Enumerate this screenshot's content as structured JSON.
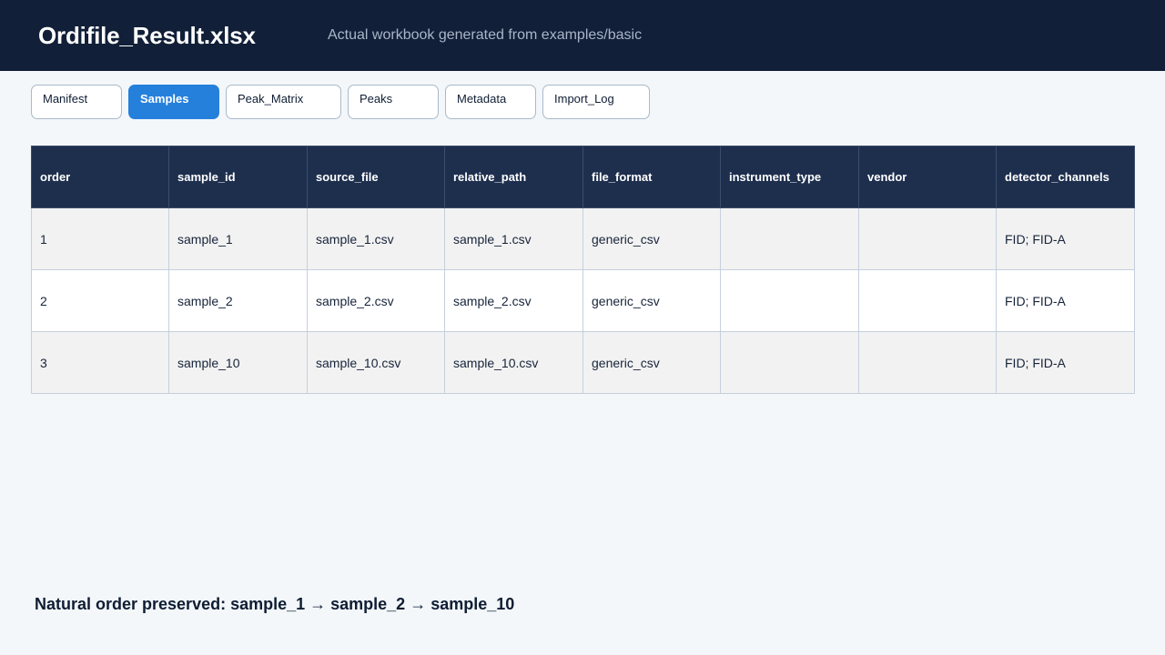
{
  "header": {
    "title": "Ordifile_Result.xlsx",
    "subtitle": "Actual workbook generated from examples/basic"
  },
  "tabs": [
    {
      "label": "Manifest",
      "active": false
    },
    {
      "label": "Samples",
      "active": true
    },
    {
      "label": "Peak_Matrix",
      "active": false
    },
    {
      "label": "Peaks",
      "active": false
    },
    {
      "label": "Metadata",
      "active": false
    },
    {
      "label": "Import_Log",
      "active": false
    }
  ],
  "table": {
    "columns": [
      "order",
      "sample_id",
      "source_file",
      "relative_path",
      "file_format",
      "instrument_type",
      "vendor",
      "detector_channels"
    ],
    "rows": [
      [
        "1",
        "sample_1",
        "sample_1.csv",
        "sample_1.csv",
        "generic_csv",
        "",
        "",
        "FID; FID-A"
      ],
      [
        "2",
        "sample_2",
        "sample_2.csv",
        "sample_2.csv",
        "generic_csv",
        "",
        "",
        "FID; FID-A"
      ],
      [
        "3",
        "sample_10",
        "sample_10.csv",
        "sample_10.csv",
        "generic_csv",
        "",
        "",
        "FID; FID-A"
      ]
    ]
  },
  "footer": {
    "note": "Natural order preserved: sample_1 → sample_2 → sample_10"
  },
  "colors": {
    "header_bg": "#111f38",
    "active_tab": "#2580dc",
    "table_header_bg": "#1e2f4e",
    "page_bg": "#f3f7fa"
  }
}
